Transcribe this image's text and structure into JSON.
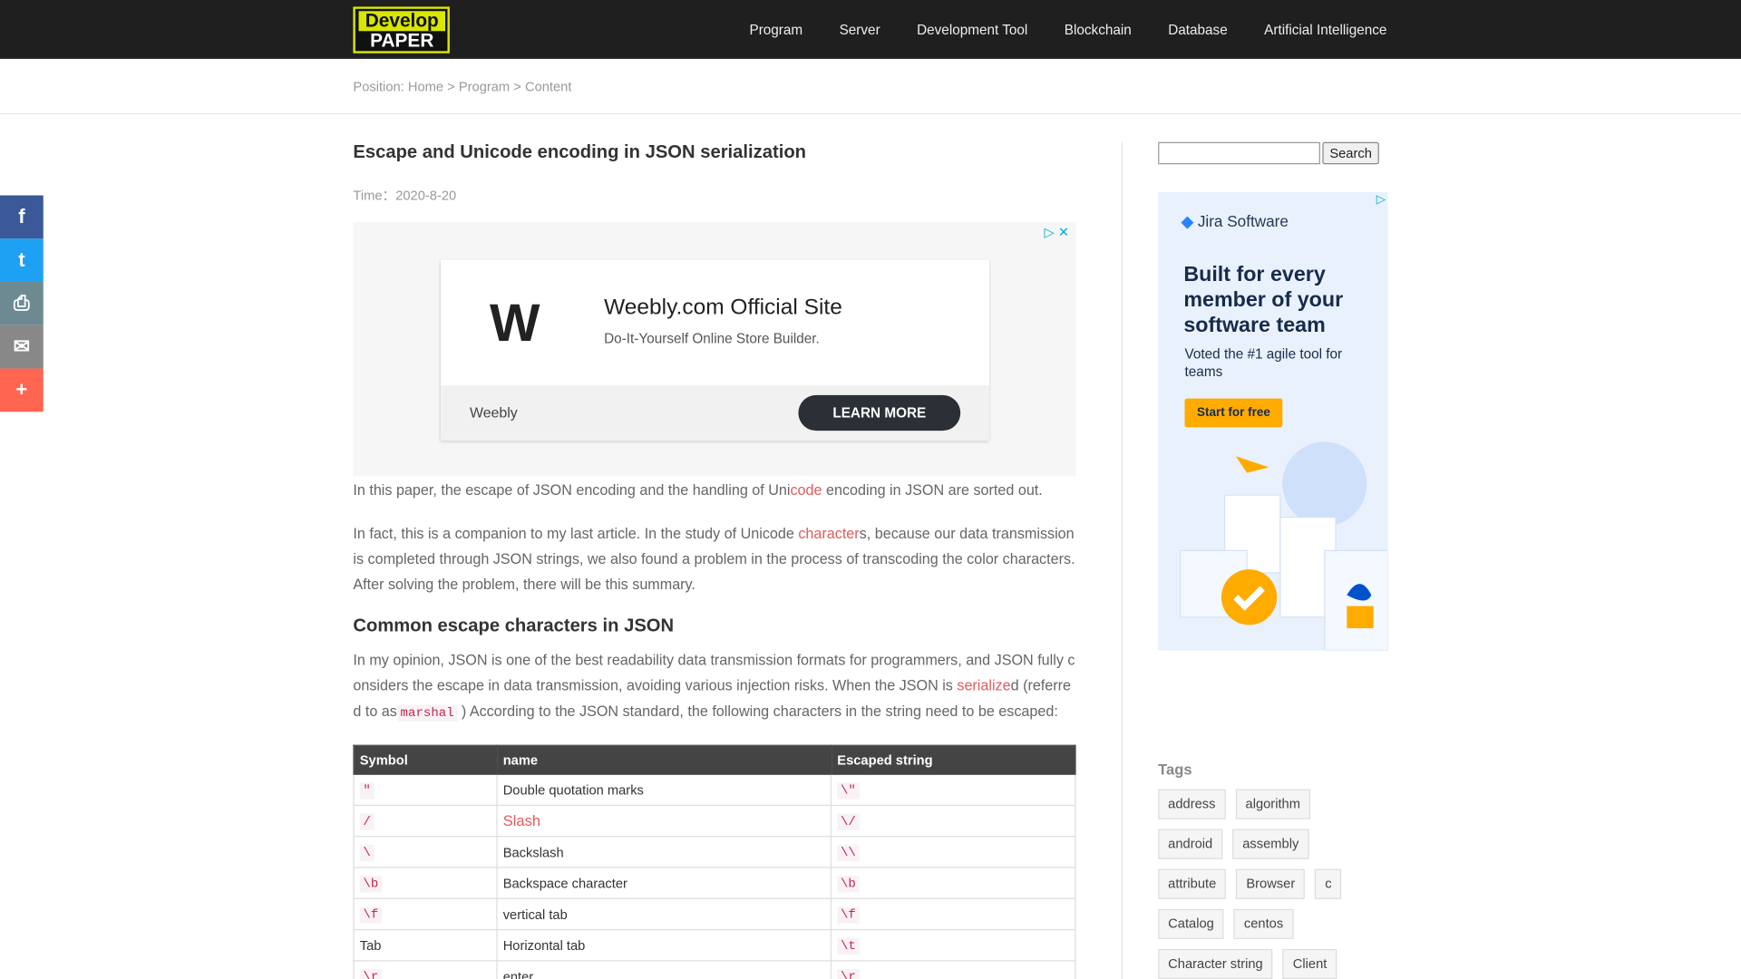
{
  "logo": {
    "line1": "Develop",
    "line2": "PAPER"
  },
  "nav": [
    "Program",
    "Server",
    "Development Tool",
    "Blockchain",
    "Database",
    "Artificial Intelligence"
  ],
  "breadcrumb": {
    "label": "Position:",
    "home": "Home",
    "sep": ">",
    "program": "Program",
    "content": "Content"
  },
  "share": [
    {
      "icon": "facebook-icon",
      "glyph": "f",
      "color": "#3b5998"
    },
    {
      "icon": "twitter-icon",
      "glyph": "t",
      "color": "#1da1f2"
    },
    {
      "icon": "print-icon",
      "glyph": "⎙",
      "color": "#6d8a93"
    },
    {
      "icon": "email-icon",
      "glyph": "✉",
      "color": "#888888"
    },
    {
      "icon": "more-icon",
      "glyph": "+",
      "color": "#ff6550"
    }
  ],
  "article": {
    "title": "Escape and Unicode encoding in JSON serialization",
    "time": "Time：2020-8-20",
    "p1_a": "In this paper, the escape of JSON encoding and the handling of Uni",
    "p1_link": "code",
    "p1_b": " encoding in JSON are sorted out.",
    "p2_a": "In fact, this is a companion to my last article. In the study of Unicode ",
    "p2_link": "character",
    "p2_b": "s, because our data transmission is completed through JSON strings, we also found a problem in the process of transcoding the color characters. After solving the problem, there will be this summary.",
    "h2": "Common escape characters in JSON",
    "p3_a": "In my opinion, JSON is one of the best readability data transmission formats for programmers, and JSON fully considers the escape in data transmission, avoiding various injection risks. When the JSON is ",
    "p3_link": "serialize",
    "p3_b": "d (referred to as",
    "p3_code": "marshal",
    "p3_c": " ) According to the JSON standard, the following characters in the string need to be escaped:"
  },
  "ad1": {
    "logo": "W",
    "headline": "Weebly.com Official Site",
    "subline": "Do-It-Yourself Online Store Builder.",
    "brand": "Weebly",
    "button": "LEARN MORE"
  },
  "table": {
    "headers": [
      "Symbol",
      "name",
      "Escaped string"
    ],
    "rows": [
      {
        "symbol": "\"",
        "name": "Double quotation marks",
        "escaped": "\\\""
      },
      {
        "symbol": "/",
        "name": "Slash",
        "escaped": "\\/"
      },
      {
        "symbol": "\\",
        "name": "Backslash",
        "escaped": "\\\\"
      },
      {
        "symbol": "\\b",
        "name": "Backspace character",
        "escaped": "\\b"
      },
      {
        "symbol": "\\f",
        "name": "vertical tab",
        "escaped": "\\f"
      },
      {
        "symbol": "Tab",
        "name": "Horizontal tab",
        "escaped": "\\t"
      },
      {
        "symbol": "\\r",
        "name": "enter",
        "escaped": "\\r"
      }
    ]
  },
  "search": {
    "placeholder": "",
    "button": "Search"
  },
  "ad2": {
    "brand": "Jira Software",
    "headline": "Built for every member of your software team",
    "voted": "Voted the #1 agile tool for teams",
    "cta": "Start for free"
  },
  "tags": {
    "title": "Tags",
    "items": [
      "address",
      "algorithm",
      "android",
      "assembly",
      "attribute",
      "Browser",
      "c",
      "Catalog",
      "centos",
      "Character string",
      "Client"
    ]
  }
}
